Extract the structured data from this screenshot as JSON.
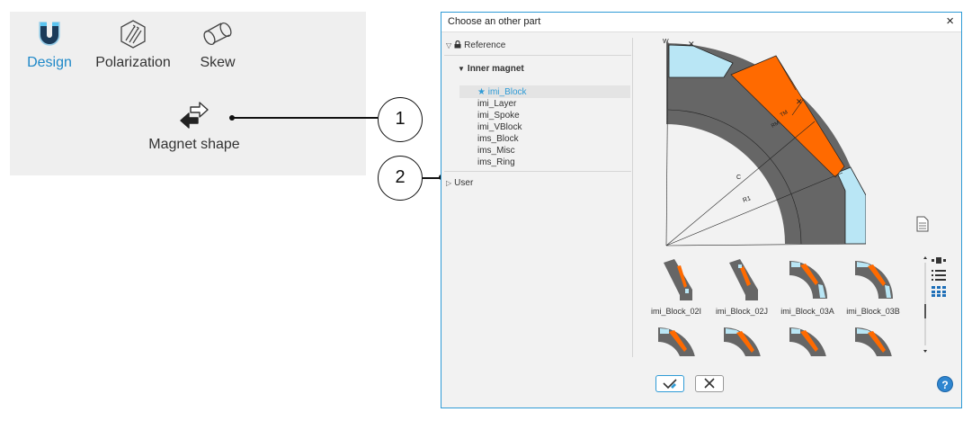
{
  "ribbon": {
    "tools": [
      {
        "label": "Design",
        "icon": "magnet-icon",
        "active": true
      },
      {
        "label": "Polarization",
        "icon": "polarization-icon",
        "active": false
      },
      {
        "label": "Skew",
        "icon": "skew-icon",
        "active": false
      }
    ],
    "shape_tool": {
      "label": "Magnet shape",
      "icon": "swap-arrows-icon"
    }
  },
  "callouts": [
    "1",
    "2"
  ],
  "dialog": {
    "title": "Choose an other part",
    "close": "×",
    "tree": {
      "reference": "Reference",
      "group": "Inner magnet",
      "items": [
        "imi_Block",
        "imi_Layer",
        "imi_Spoke",
        "imi_VBlock",
        "ims_Block",
        "ims_Misc",
        "ims_Ring"
      ],
      "selected_marker": "★",
      "user": "User"
    },
    "preview_labels": {
      "W": "W",
      "TM": "TM",
      "RM": "RM",
      "C": "C",
      "R1": "R1"
    },
    "thumbnails": [
      "imi_Block_02I",
      "imi_Block_02J",
      "imi_Block_03A",
      "imi_Block_03B"
    ],
    "help": "?"
  },
  "colors": {
    "accent": "#2f9bd6",
    "active_text": "#1e88c8",
    "magnet": "#ff6a00",
    "air": "#b9e6f5",
    "iron": "#666666"
  }
}
